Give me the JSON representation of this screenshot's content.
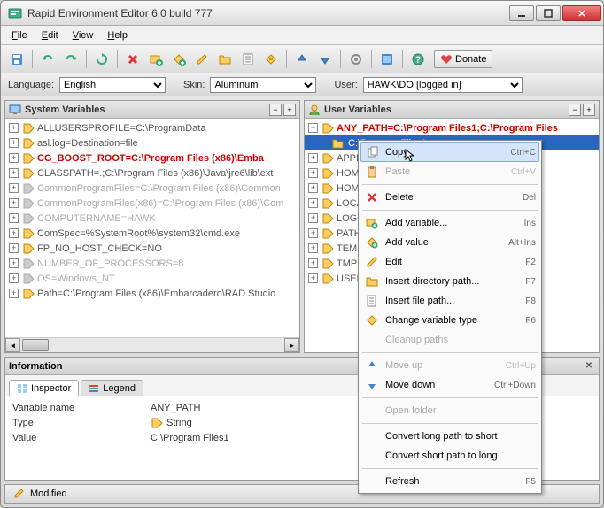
{
  "window": {
    "title": "Rapid Environment Editor 6.0 build 777"
  },
  "menu": {
    "file": "File",
    "edit": "Edit",
    "view": "View",
    "help": "Help"
  },
  "toolbar": {
    "donate": "Donate"
  },
  "options": {
    "lang_label": "Language:",
    "lang_value": "English",
    "skin_label": "Skin:",
    "skin_value": "Aluminum",
    "user_label": "User:",
    "user_value": "HAWK\\DO [logged in]"
  },
  "panes": {
    "system": {
      "title": "System Variables"
    },
    "user": {
      "title": "User Variables"
    }
  },
  "system_vars": [
    {
      "text": "ALLUSERSPROFILE=C:\\ProgramData",
      "gray": false,
      "red": false
    },
    {
      "text": "asl.log=Destination=file",
      "gray": false,
      "red": false
    },
    {
      "text": "CG_BOOST_ROOT=C:\\Program Files (x86)\\Emba",
      "gray": false,
      "red": true
    },
    {
      "text": "CLASSPATH=.;C:\\Program Files (x86)\\Java\\jre6\\lib\\ext",
      "gray": false,
      "red": false
    },
    {
      "text": "CommonProgramFiles=C:\\Program Files (x86)\\Common",
      "gray": true,
      "red": false
    },
    {
      "text": "CommonProgramFiles(x86)=C:\\Program Files (x86)\\Com",
      "gray": true,
      "red": false
    },
    {
      "text": "COMPUTERNAME=HAWK",
      "gray": true,
      "red": false
    },
    {
      "text": "ComSpec=%SystemRoot%\\system32\\cmd.exe",
      "gray": false,
      "red": false
    },
    {
      "text": "FP_NO_HOST_CHECK=NO",
      "gray": false,
      "red": false
    },
    {
      "text": "NUMBER_OF_PROCESSORS=8",
      "gray": true,
      "red": false
    },
    {
      "text": "OS=Windows_NT",
      "gray": true,
      "red": false
    },
    {
      "text": "Path=C:\\Program Files (x86)\\Embarcadero\\RAD Studio",
      "gray": false,
      "red": false
    }
  ],
  "user_vars": {
    "root": "ANY_PATH=C:\\Program Files1;C:\\Program Files",
    "child": "C:\\Program Files1",
    "rest": [
      "APPD",
      "HOM",
      "HOM",
      "LOCA",
      "LOGO",
      "PATH                                    \\Progra",
      "TEMP                                    %USER",
      "TMP",
      "USER"
    ]
  },
  "context_menu": [
    {
      "label": "Copy",
      "shortcut": "Ctrl+C",
      "icon": "copy",
      "hover": true
    },
    {
      "label": "Paste",
      "shortcut": "Ctrl+V",
      "icon": "paste",
      "disabled": true
    },
    {
      "sep": true
    },
    {
      "label": "Delete",
      "shortcut": "Del",
      "icon": "delete"
    },
    {
      "sep": true
    },
    {
      "label": "Add variable...",
      "shortcut": "Ins",
      "icon": "add-var"
    },
    {
      "label": "Add value",
      "shortcut": "Alt+Ins",
      "icon": "add-val"
    },
    {
      "label": "Edit",
      "shortcut": "F2",
      "icon": "edit"
    },
    {
      "label": "Insert directory path...",
      "shortcut": "F7",
      "icon": "dir"
    },
    {
      "label": "Insert file path...",
      "shortcut": "F8",
      "icon": "file"
    },
    {
      "label": "Change variable type",
      "shortcut": "F6",
      "icon": "type"
    },
    {
      "label": "Cleanup paths",
      "disabled": true
    },
    {
      "sep": true
    },
    {
      "label": "Move up",
      "shortcut": "Ctrl+Up",
      "icon": "up",
      "disabled": true
    },
    {
      "label": "Move down",
      "shortcut": "Ctrl+Down",
      "icon": "down"
    },
    {
      "sep": true
    },
    {
      "label": "Open folder",
      "disabled": true
    },
    {
      "sep": true
    },
    {
      "label": "Convert long path to short"
    },
    {
      "label": "Convert short path to long"
    },
    {
      "sep": true
    },
    {
      "label": "Refresh",
      "shortcut": "F5"
    }
  ],
  "info": {
    "title": "Information",
    "tabs": {
      "inspector": "Inspector",
      "legend": "Legend"
    },
    "rows": {
      "name_label": "Variable name",
      "name_value": "ANY_PATH",
      "type_label": "Type",
      "type_value": "String",
      "value_label": "Value",
      "value_value": "C:\\Program Files1"
    }
  },
  "status": {
    "modified": "Modified"
  },
  "chart_data": null
}
